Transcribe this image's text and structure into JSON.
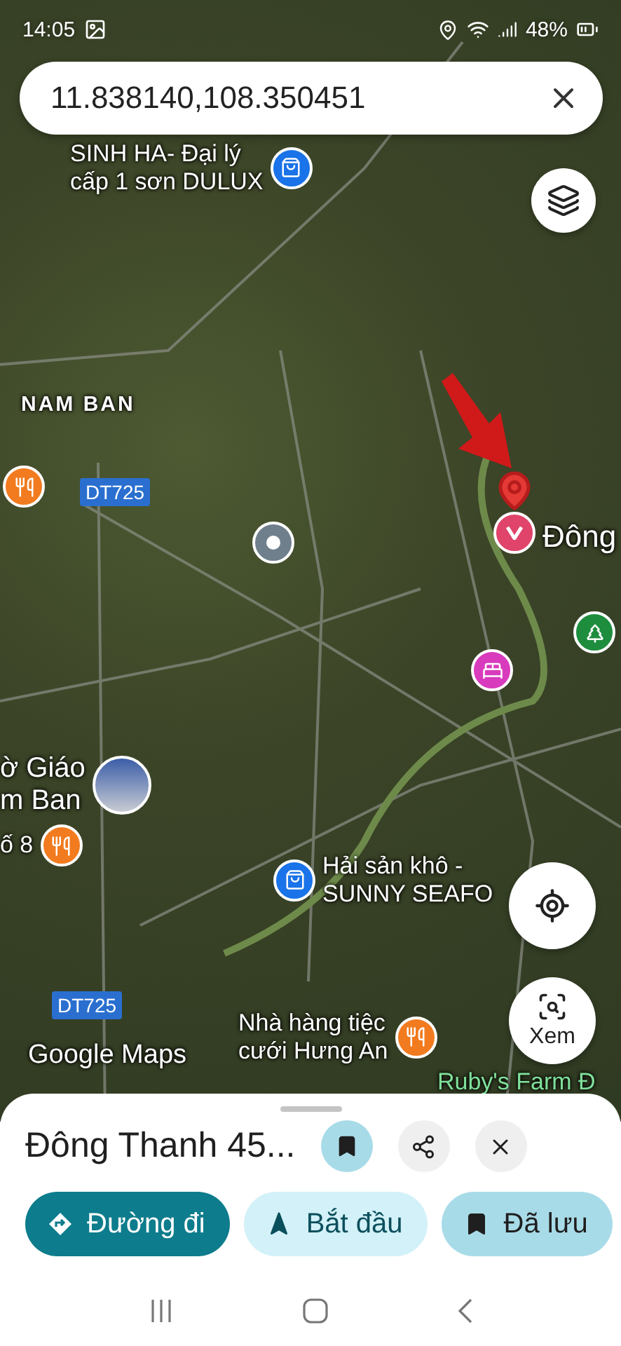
{
  "status_bar": {
    "time": "14:05",
    "battery": "48%"
  },
  "search": {
    "value": "11.838140,108.350451"
  },
  "map_markers": [
    {
      "kind": "shopping",
      "lines": [
        "SINH HA- Đại lý",
        "cấp 1 sơn DULUX"
      ]
    },
    {
      "kind": "area",
      "lines": [
        "NAM BAN"
      ]
    },
    {
      "kind": "restaurant"
    },
    {
      "kind": "road",
      "lines": [
        "DT725"
      ]
    },
    {
      "kind": "place"
    },
    {
      "kind": "selected",
      "lines": [
        "Đông"
      ]
    },
    {
      "kind": "park"
    },
    {
      "kind": "hotel"
    },
    {
      "kind": "photo",
      "lines": [
        "ờ Giáo",
        "m Ban"
      ]
    },
    {
      "kind": "restaurant",
      "lines": [
        "ố 8"
      ]
    },
    {
      "kind": "shopping",
      "lines": [
        "Hải sản khô -",
        "SUNNY SEAFO"
      ]
    },
    {
      "kind": "road",
      "lines": [
        "DT725"
      ]
    },
    {
      "kind": "restaurant",
      "lines": [
        "Nhà hàng tiệc",
        "cưới Hưng An"
      ]
    },
    {
      "kind": "poi_text",
      "lines": [
        "Ruby's Farm Đ"
      ]
    },
    {
      "kind": "brand",
      "lines": [
        "Google Maps"
      ]
    }
  ],
  "map_buttons": [
    {
      "kind": "layers"
    },
    {
      "kind": "locate"
    },
    {
      "kind": "lens",
      "label": "Xem"
    }
  ],
  "place_sheet": {
    "title": "Đông Thanh 45...",
    "saved": true,
    "chips": [
      {
        "kind": "directions",
        "label": "Đường đi"
      },
      {
        "kind": "start",
        "label": "Bắt đầu"
      },
      {
        "kind": "saved",
        "label": "Đã lưu"
      }
    ]
  }
}
